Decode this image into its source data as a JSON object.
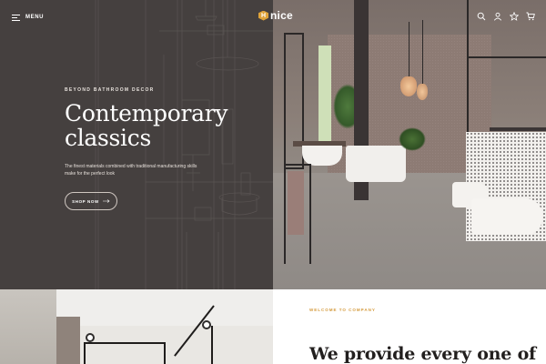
{
  "header": {
    "menu_label": "MENU",
    "logo_mark": "H",
    "logo_text": "nice",
    "icons": [
      "search-icon",
      "user-icon",
      "star-icon",
      "cart-icon"
    ]
  },
  "hero": {
    "eyebrow": "BEYOND BATHROOM DECOR",
    "title_line1": "Contemporary",
    "title_line2": "classics",
    "subtitle": "The finest materials combined with traditional manufacturing skills make for the perfect look",
    "cta_label": "SHOP NOW"
  },
  "about": {
    "eyebrow": "WELCOME TO COMPANY",
    "heading": "We provide every one of"
  },
  "colors": {
    "hero_left_bg": "#45403f",
    "accent": "#d49a3c",
    "logo": "#e0a43a",
    "heading_dark": "#221f1e"
  }
}
